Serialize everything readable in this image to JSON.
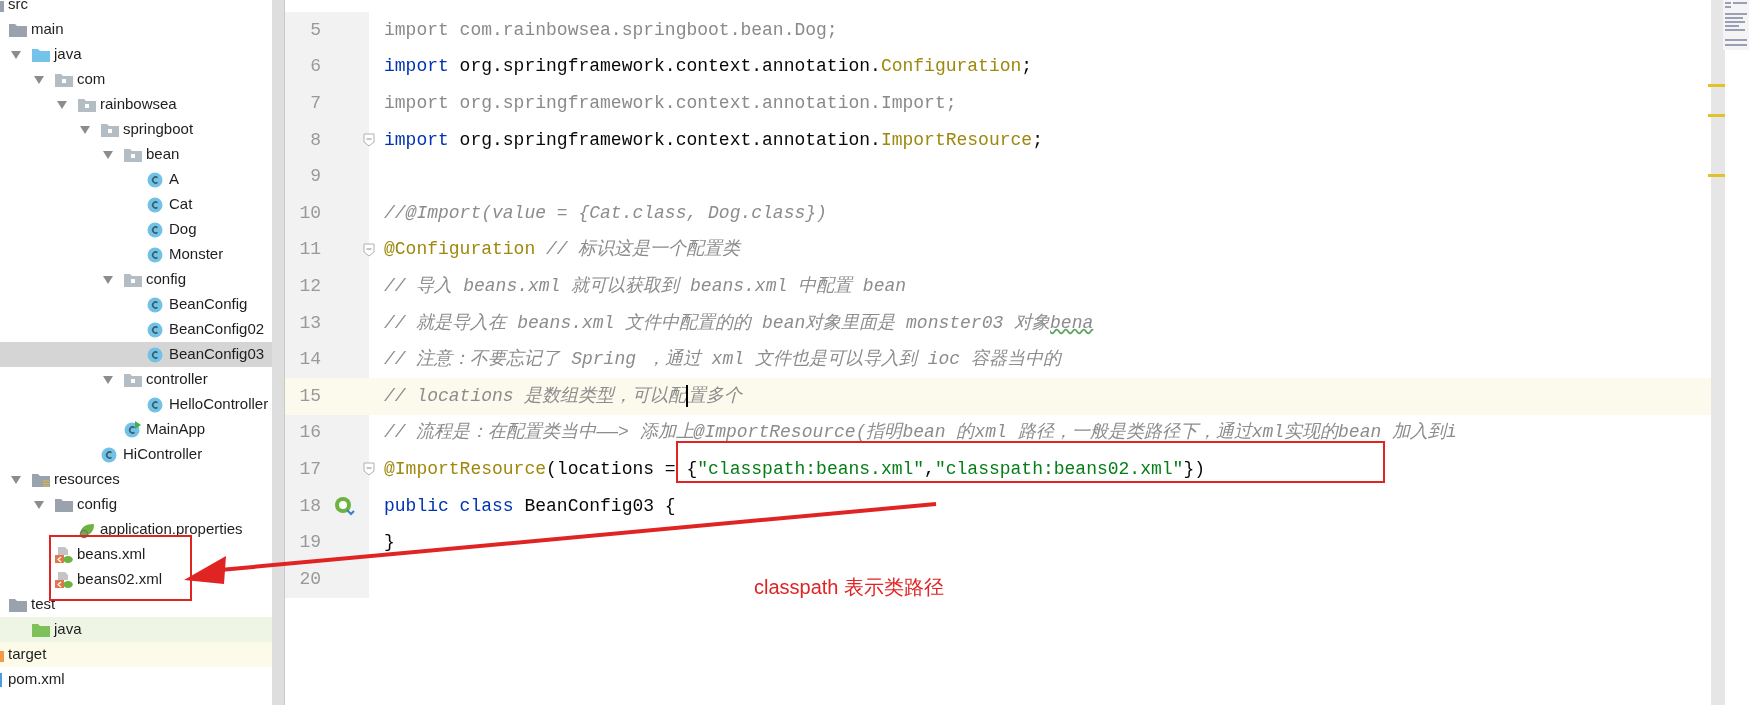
{
  "project_tree": {
    "items": [
      {
        "label": "src",
        "kind": "folder",
        "selected": false,
        "children": [
          {
            "label": "main",
            "kind": "folder",
            "selected": false,
            "children": [
              {
                "label": "java",
                "kind": "source-folder",
                "selected": false,
                "expanded": true,
                "children": [
                  {
                    "label": "com",
                    "kind": "package",
                    "selected": false,
                    "expanded": true,
                    "children": [
                      {
                        "label": "rainbowsea",
                        "kind": "package",
                        "selected": false,
                        "expanded": true,
                        "children": [
                          {
                            "label": "springboot",
                            "kind": "package",
                            "selected": false,
                            "expanded": true,
                            "children": [
                              {
                                "label": "bean",
                                "kind": "package",
                                "selected": false,
                                "expanded": true,
                                "children": [
                                  {
                                    "label": "A",
                                    "kind": "class",
                                    "selected": false
                                  },
                                  {
                                    "label": "Cat",
                                    "kind": "class",
                                    "selected": false
                                  },
                                  {
                                    "label": "Dog",
                                    "kind": "class",
                                    "selected": false
                                  },
                                  {
                                    "label": "Monster",
                                    "kind": "class",
                                    "selected": false
                                  }
                                ]
                              },
                              {
                                "label": "config",
                                "kind": "package",
                                "selected": false,
                                "expanded": true,
                                "children": [
                                  {
                                    "label": "BeanConfig",
                                    "kind": "class",
                                    "selected": false
                                  },
                                  {
                                    "label": "BeanConfig02",
                                    "kind": "class",
                                    "selected": false
                                  },
                                  {
                                    "label": "BeanConfig03",
                                    "kind": "class",
                                    "selected": true
                                  }
                                ]
                              },
                              {
                                "label": "controller",
                                "kind": "package",
                                "selected": false,
                                "expanded": true,
                                "children": [
                                  {
                                    "label": "HelloController",
                                    "kind": "class",
                                    "selected": false
                                  }
                                ]
                              },
                              {
                                "label": "MainApp",
                                "kind": "main-class",
                                "selected": false
                              }
                            ]
                          },
                          {
                            "label": "HiController",
                            "kind": "class",
                            "selected": false
                          }
                        ]
                      }
                    ]
                  }
                ]
              },
              {
                "label": "resources",
                "kind": "resource-folder",
                "selected": false,
                "expanded": true,
                "children": [
                  {
                    "label": "config",
                    "kind": "folder",
                    "selected": false,
                    "expanded": true,
                    "children": [
                      {
                        "label": "application.properties",
                        "kind": "properties",
                        "selected": false
                      }
                    ]
                  },
                  {
                    "label": "beans.xml",
                    "kind": "xml",
                    "selected": false
                  },
                  {
                    "label": "beans02.xml",
                    "kind": "xml",
                    "selected": false
                  }
                ]
              }
            ]
          },
          {
            "label": "test",
            "kind": "folder",
            "selected": false,
            "children": [
              {
                "label": "java",
                "kind": "test-folder",
                "selected": false
              }
            ]
          }
        ]
      },
      {
        "label": "target",
        "kind": "excluded-folder",
        "selected": false
      },
      {
        "label": "pom.xml",
        "kind": "maven",
        "selected": false
      }
    ]
  },
  "editor": {
    "lines": [
      {
        "number": "5",
        "tokens": [
          {
            "text": "import com.rainbowsea.springboot.bean.Dog;",
            "kind": "unused"
          }
        ]
      },
      {
        "number": "6",
        "tokens": [
          {
            "text": "import",
            "kind": "keyword"
          },
          {
            "text": " org.springframework.context.annotation.",
            "kind": "plain"
          },
          {
            "text": "Configuration",
            "kind": "annotation"
          },
          {
            "text": ";",
            "kind": "plain"
          }
        ]
      },
      {
        "number": "7",
        "tokens": [
          {
            "text": "import org.springframework.context.annotation.Import;",
            "kind": "unused"
          }
        ]
      },
      {
        "number": "8",
        "fold_marker": true,
        "tokens": [
          {
            "text": "import",
            "kind": "keyword"
          },
          {
            "text": " org.springframework.context.annotation.",
            "kind": "plain"
          },
          {
            "text": "ImportResource",
            "kind": "annotation"
          },
          {
            "text": ";",
            "kind": "plain"
          }
        ]
      },
      {
        "number": "9"
      },
      {
        "number": "10",
        "tokens": [
          {
            "text": "//@Import(value = {Cat.class, Dog.class})",
            "kind": "comment"
          }
        ]
      },
      {
        "number": "11",
        "fold_marker": true,
        "tokens": [
          {
            "text": "@Configuration",
            "kind": "annotation"
          },
          {
            "text": " // 标识这是一个配置类",
            "kind": "comment"
          }
        ]
      },
      {
        "number": "12",
        "tokens": [
          {
            "text": "// 导入 beans.xml 就可以获取到 beans.xml 中配置 bean",
            "kind": "comment"
          }
        ]
      },
      {
        "number": "13",
        "tokens": [
          {
            "text": "// 就是导入在 beans.xml 文件中配置的的 bean对象里面是 monster03 对象",
            "kind": "comment"
          },
          {
            "text": "bena",
            "kind": "comment",
            "typo": true
          }
        ]
      },
      {
        "number": "14",
        "tokens": [
          {
            "text": "// 注意：不要忘记了 Spring ，通过 xml 文件也是可以导入到 ioc 容器当中的",
            "kind": "comment"
          }
        ]
      },
      {
        "number": "15",
        "current": true,
        "tokens": [
          {
            "text": "// locations 是数组类型，可以配",
            "kind": "comment",
            "caret_after": true
          },
          {
            "text": "置多个",
            "kind": "comment"
          }
        ]
      },
      {
        "number": "16",
        "tokens": [
          {
            "text": "// 流程是：在配置类当中——> 添加上@ImportResource(指明bean 的xml 路径，一般是类路径下，通过xml实现的bean 加入到i",
            "kind": "comment"
          }
        ]
      },
      {
        "number": "17",
        "fold_marker": true,
        "tokens": [
          {
            "text": "@ImportResource",
            "kind": "annotation"
          },
          {
            "text": "(locations = {",
            "kind": "plain"
          },
          {
            "text": "\"classpath:beans.xml\"",
            "kind": "string"
          },
          {
            "text": ",",
            "kind": "plain"
          },
          {
            "text": "\"classpath:beans02.xml\"",
            "kind": "string"
          },
          {
            "text": "})",
            "kind": "plain"
          }
        ]
      },
      {
        "number": "18",
        "bean_marker": true,
        "tokens": [
          {
            "text": "public class",
            "kind": "keyword"
          },
          {
            "text": " BeanConfig03 {",
            "kind": "plain"
          }
        ]
      },
      {
        "number": "19",
        "tokens": [
          {
            "text": "}",
            "kind": "plain"
          }
        ]
      },
      {
        "number": "20"
      }
    ]
  },
  "annotation": {
    "text": "classpath 表示类路径"
  }
}
